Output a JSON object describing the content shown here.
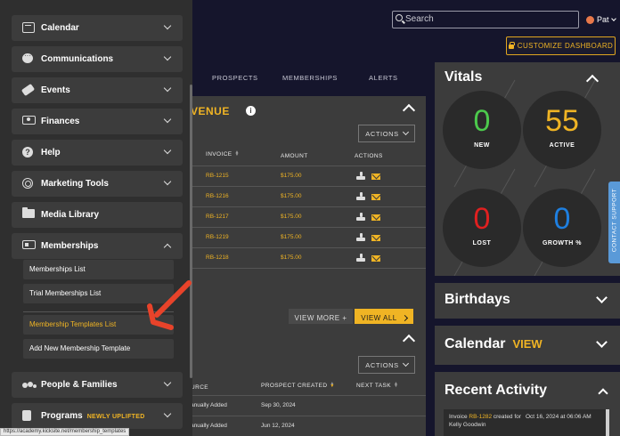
{
  "topbar": {
    "search_placeholder": "Search",
    "user_name": "Pat",
    "customize_label": "CUSTOMIZE DASHBOARD"
  },
  "main": {
    "tabs": [
      "PROSPECTS",
      "MEMBERSHIPS",
      "ALERTS"
    ],
    "revenue": {
      "title": "VENUE",
      "actions_label": "ACTIONS",
      "headers": {
        "invoice": "INVOICE",
        "amount": "AMOUNT",
        "actions": "ACTIONS"
      },
      "rows": [
        {
          "invoice": "RB-1215",
          "amount": "$175.00"
        },
        {
          "invoice": "RB-1216",
          "amount": "$175.00"
        },
        {
          "invoice": "RB-1217",
          "amount": "$175.00"
        },
        {
          "invoice": "RB-1219",
          "amount": "$175.00"
        },
        {
          "invoice": "RB-1218",
          "amount": "$175.00"
        }
      ],
      "view_more": "VIEW MORE +",
      "view_all": "VIEW ALL"
    },
    "prospects": {
      "actions_label": "ACTIONS",
      "headers": {
        "source": "URCE",
        "created": "PROSPECT CREATED",
        "next_task": "NEXT TASK"
      },
      "rows": [
        {
          "source": "anually Added",
          "created": "Sep 30, 2024"
        },
        {
          "source": "anually Added",
          "created": "Jun 12, 2024"
        }
      ]
    }
  },
  "vitals": {
    "title": "Vitals",
    "stats": [
      {
        "value": "0",
        "label": "NEW",
        "color": "#4cc94c"
      },
      {
        "value": "55",
        "label": "ACTIVE",
        "color": "#f0b424"
      },
      {
        "value": "0",
        "label": "LOST",
        "color": "#e02020"
      },
      {
        "value": "0",
        "label": "GROWTH %",
        "color": "#1e7fe0"
      }
    ]
  },
  "birthdays": {
    "title": "Birthdays"
  },
  "calendar": {
    "title": "Calendar",
    "view_label": "VIEW"
  },
  "recent_activity": {
    "title": "Recent Activity",
    "item": {
      "prefix": "Invoice ",
      "invoice": "RB-1282",
      "suffix": " created for Kelly Goodwin",
      "time": "Oct 16, 2024 at 06:06 AM"
    }
  },
  "contact_support": "CONTACT SUPPORT",
  "sidebar": {
    "items": [
      {
        "label": "Calendar",
        "icon": "calendar-icon"
      },
      {
        "label": "Communications",
        "icon": "chat-icon"
      },
      {
        "label": "Events",
        "icon": "tag-icon"
      },
      {
        "label": "Finances",
        "icon": "money-icon"
      },
      {
        "label": "Help",
        "icon": "help-icon"
      },
      {
        "label": "Marketing Tools",
        "icon": "target-icon"
      },
      {
        "label": "Media Library",
        "icon": "folder-icon"
      },
      {
        "label": "Memberships",
        "icon": "membership-card-icon"
      },
      {
        "label": "People & Families",
        "icon": "people-icon"
      },
      {
        "label": "Programs",
        "icon": "programs-icon",
        "badge": "NEWLY UPLIFTED"
      }
    ],
    "membership_sub": [
      "Memberships List",
      "Trial Memberships List",
      "Membership Templates List",
      "Add New Membership Template"
    ]
  },
  "status_url": "https://academy.kicksite.net/membership_templates"
}
